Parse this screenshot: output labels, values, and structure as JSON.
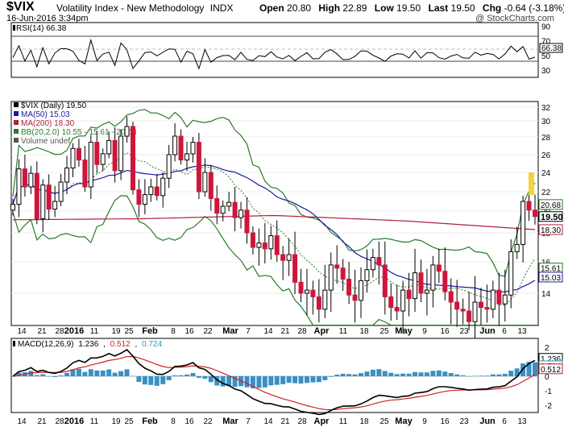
{
  "header": {
    "symbol": "$VIX",
    "name": "Volatility Index - New Methodology",
    "exchange": "INDX",
    "date": "16-Jun-2016 3:34pm",
    "open_label": "Open",
    "open": "20.80",
    "high_label": "High",
    "high": "22.89",
    "low_label": "Low",
    "low": "19.50",
    "last_label": "Last",
    "last": "19.50",
    "chg_label": "Chg",
    "chg": "-0.64 (-3.18%)",
    "watermark": "@ StockCharts.com"
  },
  "rsi": {
    "legend": "RSI(14) 66.38",
    "ticks": [
      "90",
      "70",
      "50",
      "30"
    ],
    "value_label": "66.38"
  },
  "main": {
    "legend": [
      "$VIX (Daily) 19.50",
      "MA(50) 15.03",
      "MA(200) 18.30",
      "BB(20,2.0) 10.55 - 15.61 - 20.68",
      "Volume undef"
    ],
    "legend_colors": [
      "#000000",
      "#1a1aa0",
      "#b0203a",
      "#2a7a2a",
      "#555555"
    ],
    "y_ticks": [
      "32",
      "30",
      "28",
      "26",
      "24",
      "22",
      "20",
      "18",
      "16",
      "14"
    ],
    "value_labels": [
      "20.68",
      "19.50",
      "18.30",
      "15.61",
      "15.03"
    ]
  },
  "macd": {
    "legend_prefix": "MACD(12,26,9)",
    "macd": "1.236",
    "signal": "0.512",
    "hist": "0.724",
    "colors": {
      "macd": "#000000",
      "signal": "#cc2222",
      "hist": "#3a8fc4"
    },
    "ticks": [
      "2",
      "1",
      "0",
      "-1",
      "-2"
    ],
    "value_labels": [
      "1.236",
      "0.724",
      "0.512"
    ]
  },
  "x_axis": {
    "labels": [
      "14",
      "21",
      "28",
      "2016",
      "11",
      "19",
      "25",
      "Feb",
      "8",
      "16",
      "22",
      "Mar",
      "7",
      "14",
      "21",
      "28",
      "Apr",
      "11",
      "18",
      "25",
      "May",
      "9",
      "16",
      "23",
      "Jun",
      "6",
      "13"
    ],
    "bold": [
      "2016",
      "Feb",
      "Mar",
      "Apr",
      "May",
      "Jun"
    ]
  },
  "chart_data": {
    "type": "line",
    "title": "$VIX Volatility Index - New Methodology",
    "ylim": [
      12,
      33
    ],
    "series": [
      {
        "name": "$VIX (Daily)",
        "values": [
          20.7,
          24.4,
          22.5,
          23.9,
          19.3,
          22.7,
          20.2,
          21.0,
          23.0,
          24.5,
          26.7,
          25.4,
          22.5,
          27.4,
          24.9,
          26.1,
          27.6,
          24.2,
          28.1,
          29.3,
          22.2,
          20.7,
          21.7,
          22.5,
          21.6,
          23.4,
          26.0,
          28.1,
          25.4,
          26.1,
          27.4,
          22.0,
          24.0,
          21.3,
          19.8,
          20.5,
          20.9,
          19.4,
          20.1,
          18.0,
          17.0,
          17.3,
          16.9,
          17.8,
          16.5,
          16.1,
          16.5,
          14.7,
          14.0,
          14.2,
          13.8,
          13.1,
          14.2,
          15.8,
          15.6,
          14.9,
          13.9,
          13.6,
          14.8,
          15.5,
          16.3,
          15.8,
          13.8,
          13.2,
          13.0,
          14.2,
          13.7,
          15.3,
          14.0,
          14.2,
          15.8,
          15.4,
          14.1,
          13.5,
          13.1,
          13.0,
          12.4,
          13.5,
          13.2,
          13.1,
          14.2,
          13.4,
          13.9,
          16.7,
          17.2,
          21.0,
          20.1,
          19.5
        ]
      },
      {
        "name": "MA(50)",
        "values": [
          17.8,
          22.5,
          24.6,
          21.6,
          19.4,
          15.0
        ]
      },
      {
        "name": "MA(200)",
        "values": [
          19.2,
          19.3,
          19.6,
          19.1,
          18.3
        ]
      },
      {
        "name": "BB Upper",
        "values": [
          25.0,
          30.1,
          28.9,
          26.1,
          16.6,
          20.7
        ]
      },
      {
        "name": "BB Lower",
        "values": [
          19.4,
          16.6,
          21.8,
          13.9,
          13.0,
          10.6
        ]
      }
    ]
  }
}
